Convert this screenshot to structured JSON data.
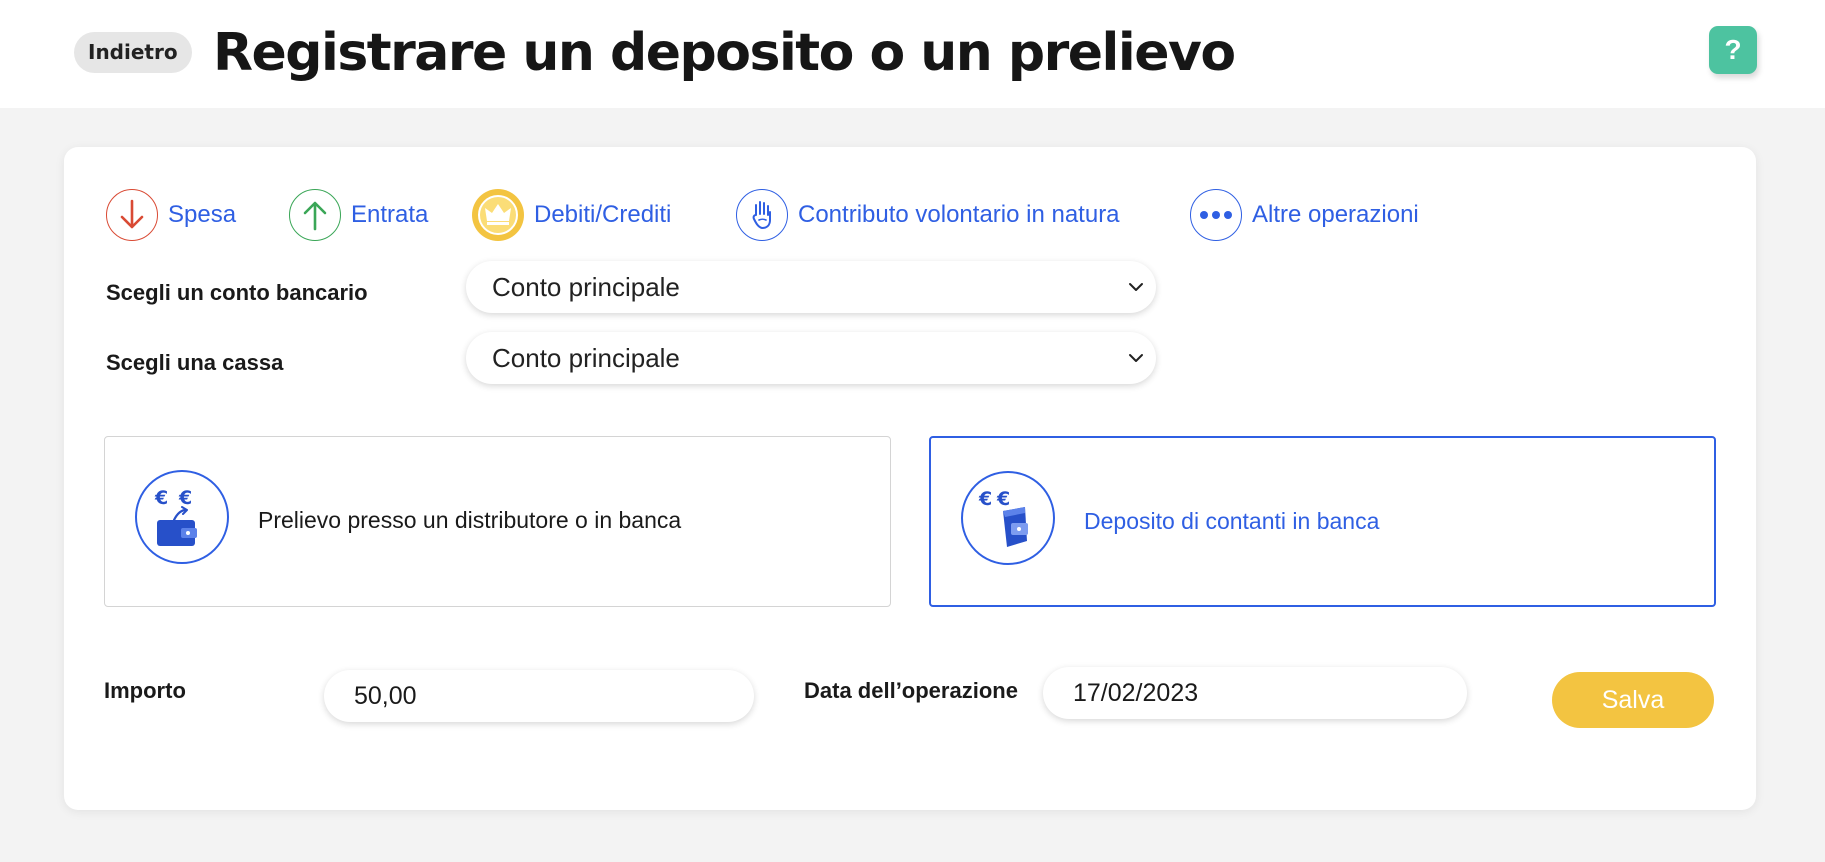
{
  "header": {
    "back_label": "Indietro",
    "title": "Registrare un deposito o un prelievo",
    "help_label": "?"
  },
  "type_tabs": [
    {
      "label": "Spesa",
      "icon": "arrow-down-icon",
      "color": "#d94a34"
    },
    {
      "label": "Entrata",
      "icon": "arrow-up-icon",
      "color": "#3aa657"
    },
    {
      "label": "Debiti/Crediti",
      "icon": "crown-icon",
      "color": "#f3c441"
    },
    {
      "label": "Contributo volontario in natura",
      "icon": "hand-icon",
      "color": "#2f5fe3"
    },
    {
      "label": "Altre operazioni",
      "icon": "more-dots-icon",
      "color": "#2f5fe3"
    }
  ],
  "form": {
    "bank_account_label": "Scegli un conto bancario",
    "bank_account_value": "Conto principale",
    "cash_label": "Scegli una cassa",
    "cash_value": "Conto principale"
  },
  "options": [
    {
      "label": "Prelievo presso un distributore o in banca",
      "icon": "wallet-euro-icon",
      "selected": false
    },
    {
      "label": "Deposito di contanti in banca",
      "icon": "wallet-deposit-euro-icon",
      "selected": true
    }
  ],
  "amount": {
    "label": "Importo",
    "value": "50,00"
  },
  "date": {
    "label": "Data dell’operazione",
    "value": "17/02/2023"
  },
  "save_label": "Salva",
  "colors": {
    "accent_blue": "#2f5fe3",
    "help_green": "#4dc3a0",
    "save_yellow": "#f3c441"
  }
}
